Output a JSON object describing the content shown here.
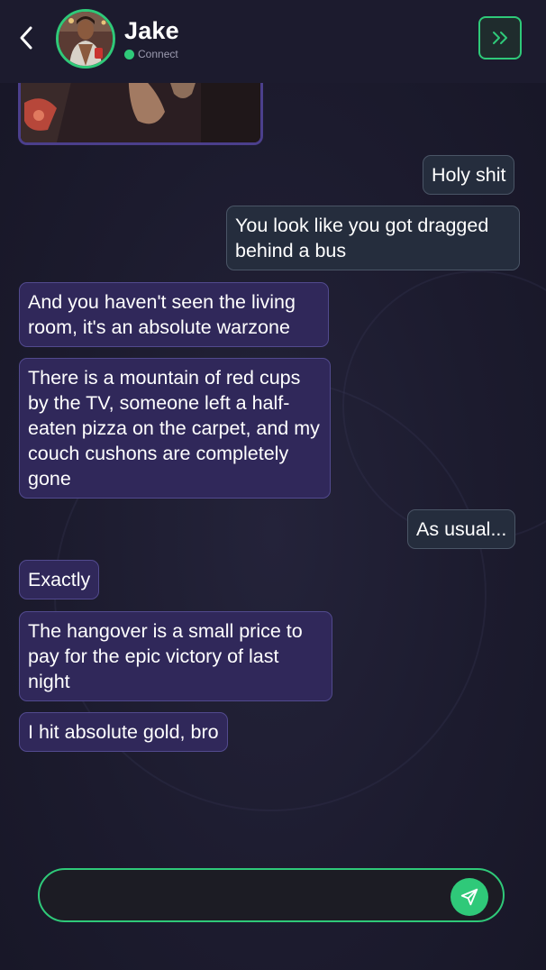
{
  "header": {
    "contact_name": "Jake",
    "status": "Connect",
    "back_icon": "chevron-left-icon",
    "skip_icon": "double-chevron-right-icon"
  },
  "messages": [
    {
      "side": "out",
      "text": "Holy shit"
    },
    {
      "side": "out",
      "text": "You look like you got dragged behind a bus"
    },
    {
      "side": "in",
      "text": "And you haven't seen the living room, it's an absolute warzone"
    },
    {
      "side": "in",
      "text": "There is a mountain of red cups by the TV, someone left a half-eaten pizza on the carpet, and my couch cushons are completely gone"
    },
    {
      "side": "out",
      "text": "As usual..."
    },
    {
      "side": "in",
      "text": "Exactly"
    },
    {
      "side": "in",
      "text": "The hangover is a small price to pay for the epic victory of last night"
    },
    {
      "side": "in",
      "text": "I hit absolute gold, bro"
    }
  ],
  "input": {
    "value": "",
    "placeholder": ""
  },
  "colors": {
    "accent": "#2fc979",
    "background": "#1c1b2e",
    "incoming_bubble": "#30285a",
    "outgoing_bubble": "#252d3d"
  }
}
